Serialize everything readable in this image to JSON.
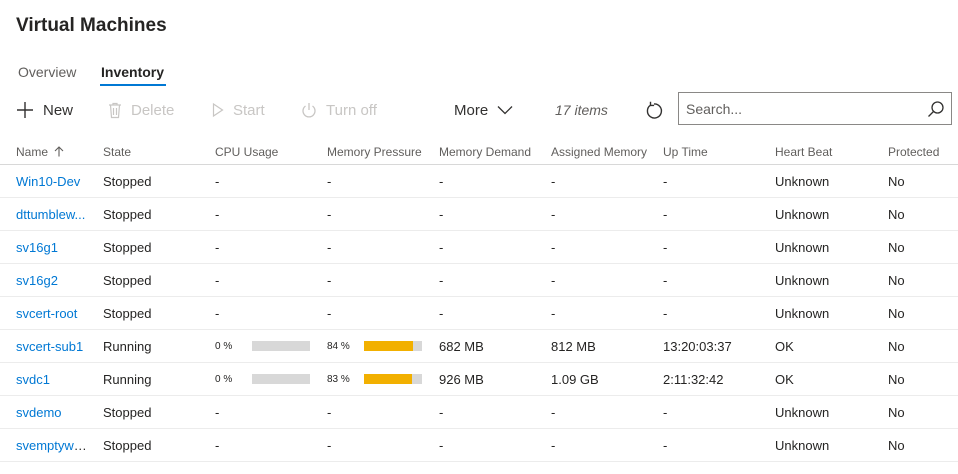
{
  "title": "Virtual Machines",
  "tabs": [
    {
      "label": "Overview",
      "active": false
    },
    {
      "label": "Inventory",
      "active": true
    }
  ],
  "toolbar": {
    "new": "New",
    "delete": "Delete",
    "start": "Start",
    "turn_off": "Turn off",
    "more": "More",
    "items_count": "17 items"
  },
  "search": {
    "placeholder": "Search...",
    "value": ""
  },
  "columns": [
    "Name",
    "State",
    "CPU Usage",
    "Memory Pressure",
    "Memory Demand",
    "Assigned Memory",
    "Up Time",
    "Heart Beat",
    "Protected"
  ],
  "colors": {
    "accent": "#0078d4",
    "bar_fill": "#f2b000",
    "bar_track": "#d8d8d8"
  },
  "rows": [
    {
      "name": "Win10-Dev",
      "state": "Stopped",
      "cpu": "-",
      "mem_pressure": "-",
      "mem_demand": "-",
      "assigned": "-",
      "uptime": "-",
      "heartbeat": "Unknown",
      "protected": "No"
    },
    {
      "name": "dttumblew...",
      "state": "Stopped",
      "cpu": "-",
      "mem_pressure": "-",
      "mem_demand": "-",
      "assigned": "-",
      "uptime": "-",
      "heartbeat": "Unknown",
      "protected": "No"
    },
    {
      "name": "sv16g1",
      "state": "Stopped",
      "cpu": "-",
      "mem_pressure": "-",
      "mem_demand": "-",
      "assigned": "-",
      "uptime": "-",
      "heartbeat": "Unknown",
      "protected": "No"
    },
    {
      "name": "sv16g2",
      "state": "Stopped",
      "cpu": "-",
      "mem_pressure": "-",
      "mem_demand": "-",
      "assigned": "-",
      "uptime": "-",
      "heartbeat": "Unknown",
      "protected": "No"
    },
    {
      "name": "svcert-root",
      "state": "Stopped",
      "cpu": "-",
      "mem_pressure": "-",
      "mem_demand": "-",
      "assigned": "-",
      "uptime": "-",
      "heartbeat": "Unknown",
      "protected": "No"
    },
    {
      "name": "svcert-sub1",
      "state": "Running",
      "cpu": "0 %",
      "cpu_value": 0,
      "mem_pressure": "84 %",
      "mem_pressure_value": 84,
      "mem_demand": "682 MB",
      "assigned": "812 MB",
      "uptime": "13:20:03:37",
      "heartbeat": "OK",
      "protected": "No"
    },
    {
      "name": "svdc1",
      "state": "Running",
      "cpu": "0 %",
      "cpu_value": 0,
      "mem_pressure": "83 %",
      "mem_pressure_value": 83,
      "mem_demand": "926 MB",
      "assigned": "1.09 GB",
      "uptime": "2:11:32:42",
      "heartbeat": "OK",
      "protected": "No"
    },
    {
      "name": "svdemo",
      "state": "Stopped",
      "cpu": "-",
      "mem_pressure": "-",
      "mem_demand": "-",
      "assigned": "-",
      "uptime": "-",
      "heartbeat": "Unknown",
      "protected": "No"
    },
    {
      "name": "svemptywi...",
      "state": "Stopped",
      "cpu": "-",
      "mem_pressure": "-",
      "mem_demand": "-",
      "assigned": "-",
      "uptime": "-",
      "heartbeat": "Unknown",
      "protected": "No"
    }
  ]
}
